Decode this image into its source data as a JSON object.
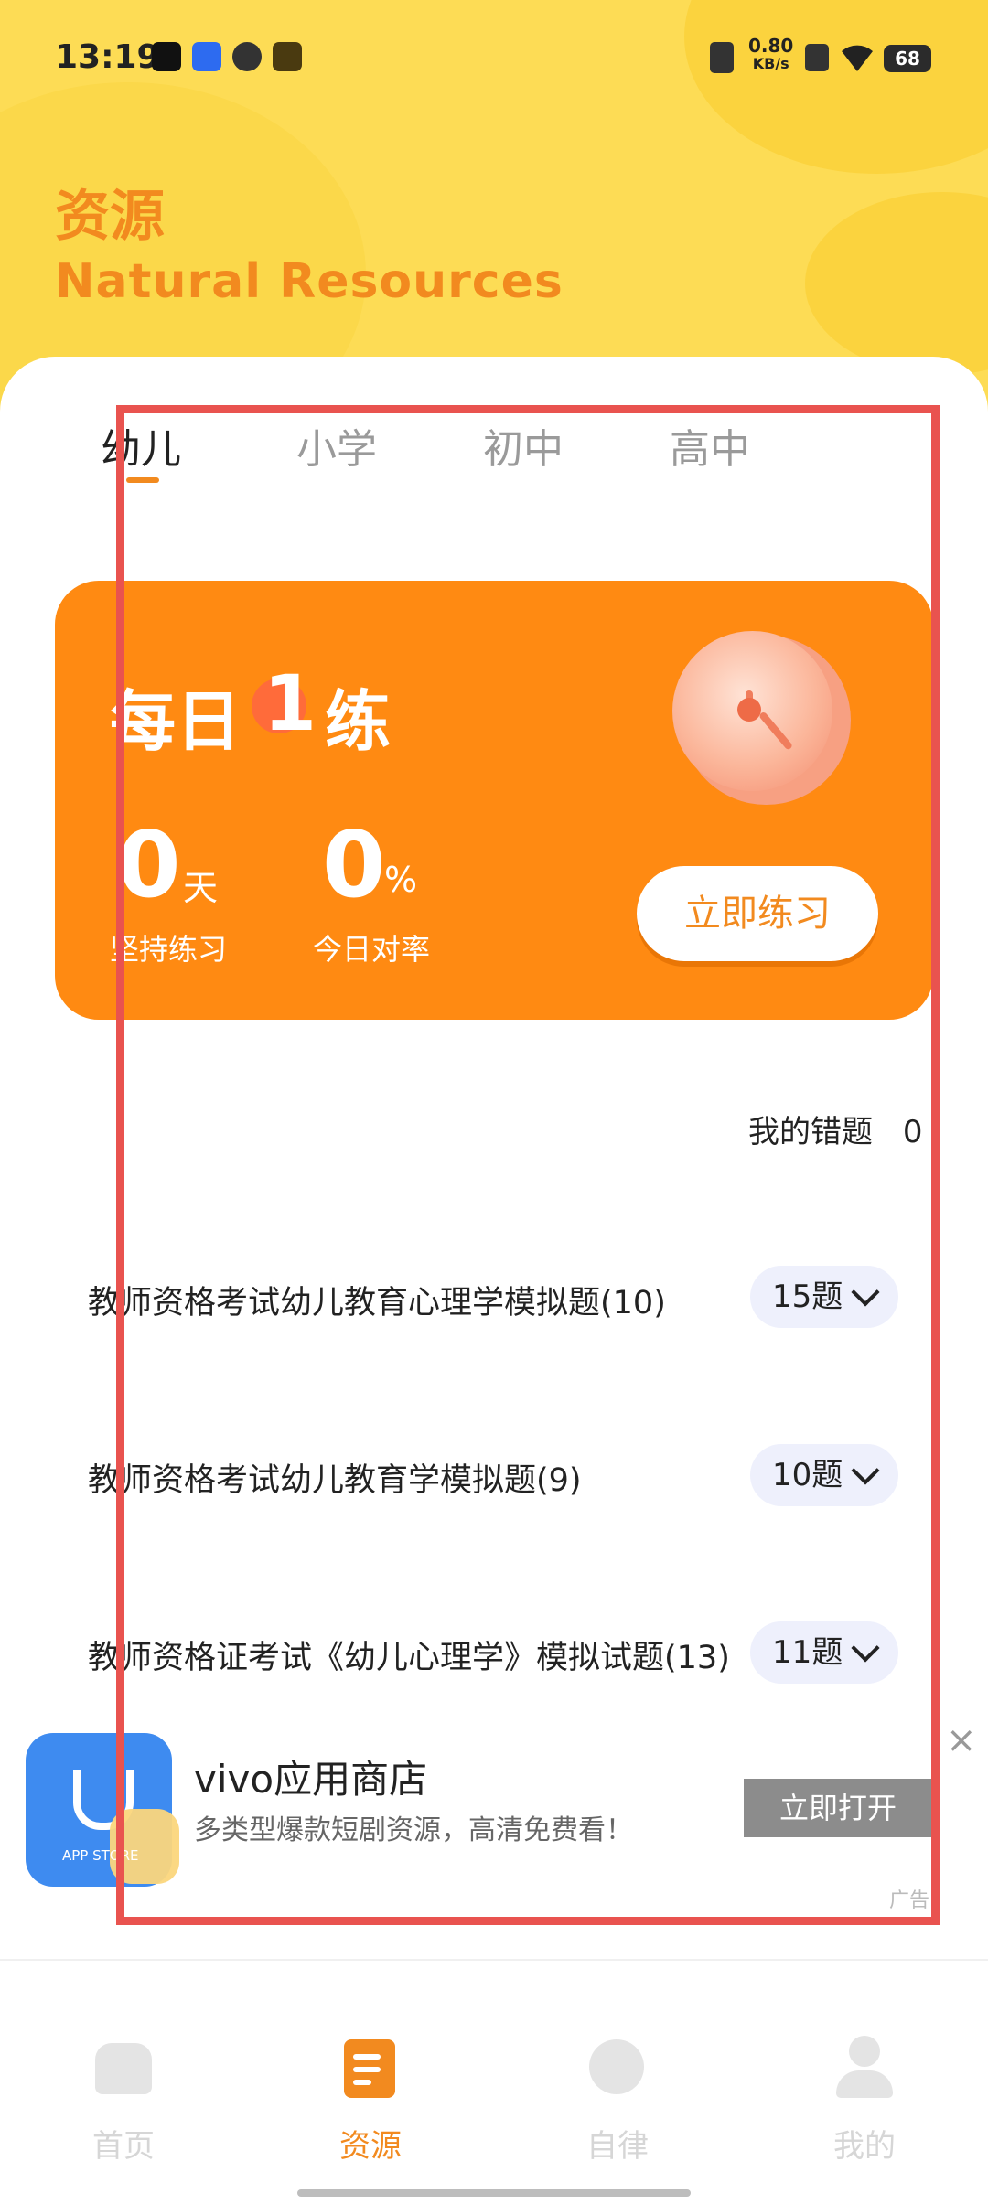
{
  "status_bar": {
    "time": "13:19",
    "network_speed_value": "0.80",
    "network_speed_unit": "KB/s",
    "battery": "68"
  },
  "header": {
    "title_cn": "资源",
    "title_en": "Natural Resources"
  },
  "tabs": [
    {
      "label": "幼儿",
      "active": true
    },
    {
      "label": "小学",
      "active": false
    },
    {
      "label": "初中",
      "active": false
    },
    {
      "label": "高中",
      "active": false
    }
  ],
  "practice_card": {
    "title_prefix": "每日",
    "title_number": "1",
    "title_suffix": "练",
    "streak_value": "0",
    "streak_unit": "天",
    "streak_label": "坚持练习",
    "accuracy_value": "0",
    "accuracy_unit": "%",
    "accuracy_label": "今日对率",
    "button_label": "立即练习"
  },
  "wrong_questions": {
    "label": "我的错题",
    "count": "0"
  },
  "exam_list": [
    {
      "title": "教师资格考试幼儿教育心理学模拟题(10)",
      "count": "15题"
    },
    {
      "title": "教师资格考试幼儿教育学模拟题(9)",
      "count": "10题"
    },
    {
      "title": "教师资格证考试《幼儿心理学》模拟试题(13)",
      "count": "11题"
    }
  ],
  "ad": {
    "icon_text": "APP STORE",
    "title": "vivo应用商店",
    "description": "多类型爆款短剧资源，高清免费看！",
    "button_label": "立即打开",
    "mark": "广告",
    "close_symbol": "×"
  },
  "bottom_nav": [
    {
      "label": "首页",
      "icon": "home-icon",
      "active": false
    },
    {
      "label": "资源",
      "icon": "document-icon",
      "active": true
    },
    {
      "label": "自律",
      "icon": "stopwatch-icon",
      "active": false
    },
    {
      "label": "我的",
      "icon": "person-icon",
      "active": false
    }
  ],
  "colors": {
    "accent": "#F28A1F",
    "header_yellow": "#FDDC55",
    "card_orange": "#FF8A12",
    "overlay_red": "#E9534F"
  }
}
